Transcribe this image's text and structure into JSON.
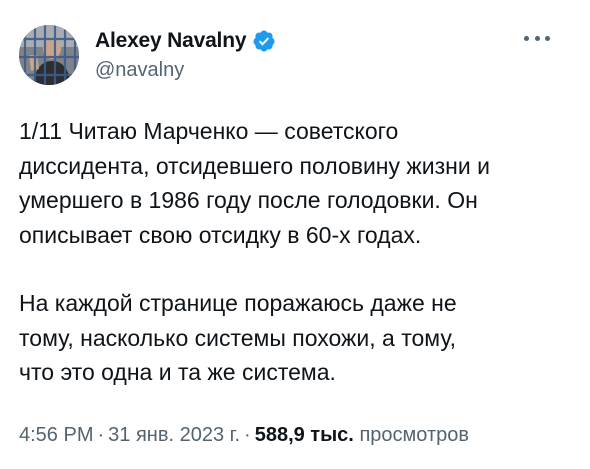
{
  "author": {
    "display_name": "Alexey Navalny",
    "handle": "@navalny",
    "verified": true,
    "verified_color": "#1d9bf0"
  },
  "tweet": {
    "paragraphs": [
      {
        "lines": [
          "1/11 Читаю Марченко — советского",
          "диссидента, отсидевшего половину жизни и",
          "умершего в 1986 году после голодовки. Он",
          "описывает свою отсидку в 60-х годах."
        ]
      },
      {
        "lines": [
          "На каждой странице поражаюсь даже не",
          "тому, насколько системы похожи, а тому,",
          "что это одна и та же система."
        ]
      }
    ]
  },
  "meta": {
    "time": "4:56 PM",
    "separator": "·",
    "date": "31 янв. 2023 г.",
    "views_count": "588,9 тыс.",
    "views_label": "просмотров"
  },
  "icons": {
    "more": "more-horizontal-icon",
    "verified": "verified-badge-icon"
  }
}
